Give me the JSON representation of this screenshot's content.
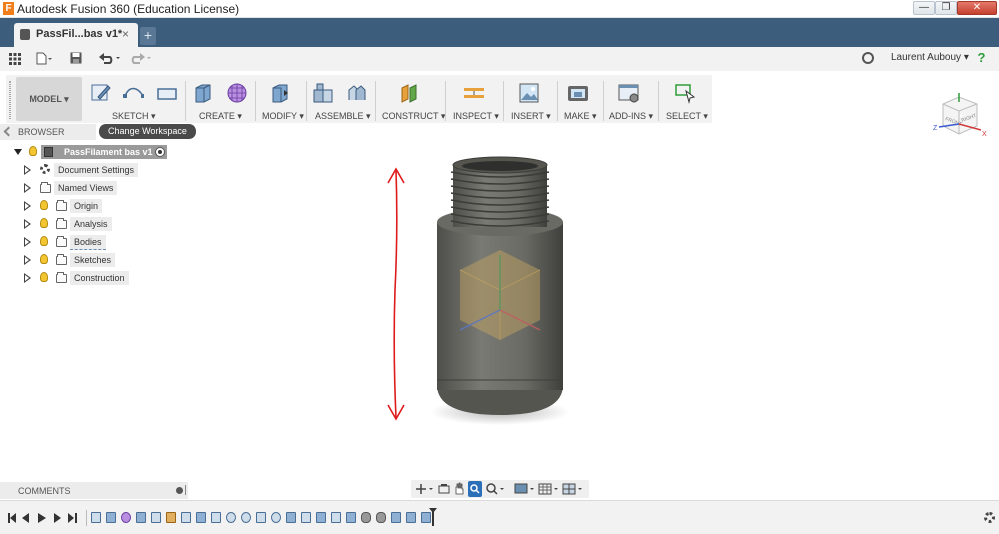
{
  "window": {
    "title": "Autodesk Fusion 360 (Education License)",
    "logo_letter": "F",
    "minimize": "—",
    "maximize": "❐",
    "close": "✕"
  },
  "tabs": [
    {
      "label": "PassFil...bas v1*",
      "close": "×"
    }
  ],
  "new_tab": "+",
  "qat": {
    "user_name": "Laurent Aubouy ▾",
    "help": "?"
  },
  "toolbar": {
    "workspace": "MODEL ▾",
    "groups": [
      "SKETCH ▾",
      "CREATE ▾",
      "MODIFY ▾",
      "ASSEMBLE ▾",
      "CONSTRUCT ▾",
      "INSPECT ▾",
      "INSERT ▾",
      "MAKE ▾",
      "ADD-INS ▾",
      "SELECT ▾"
    ]
  },
  "tooltip": "Change Workspace",
  "browser": {
    "title": "BROWSER",
    "root": "PassFilament bas v1",
    "items": [
      "Document Settings",
      "Named Views",
      "Origin",
      "Analysis",
      "Bodies",
      "Sketches",
      "Construction"
    ]
  },
  "viewcube": {
    "front": "FRONT",
    "right": "RIGHT",
    "axis_z": "Z",
    "axis_x": "X"
  },
  "comments": {
    "label": "COMMENTS"
  },
  "colors": {
    "tab_bar": "#3d5d7c",
    "model_body": "#6d6d68",
    "annotation_arrow": "#e01b1b",
    "origin_cube": "#d7b262"
  }
}
